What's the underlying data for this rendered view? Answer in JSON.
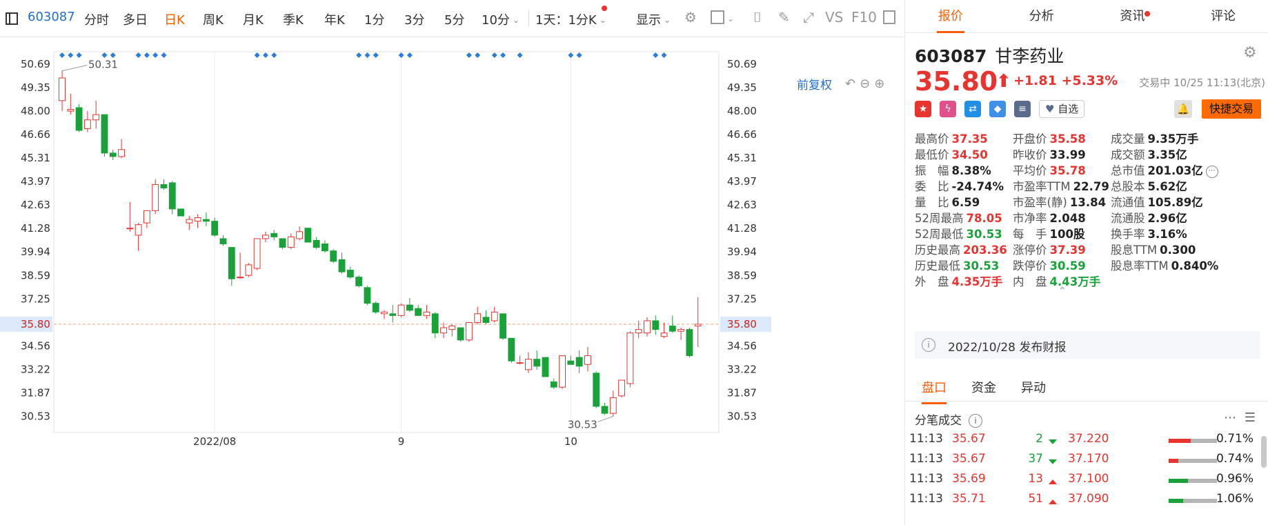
{
  "toolbar": {
    "code": "603087",
    "items": [
      "分时",
      "多日",
      "日K",
      "周K",
      "月K",
      "季K",
      "年K",
      "1分",
      "3分",
      "5分",
      "10分",
      "1天：1分K",
      "显示"
    ],
    "active_index": 2,
    "vs": "VS",
    "f10": "F10"
  },
  "chart": {
    "fq_label": "前复权",
    "price_label": "35.80",
    "high_label": "50.31",
    "low_label": "30.53",
    "x_labels": [
      "2022/08",
      "9",
      "10"
    ]
  },
  "chart_data": {
    "type": "candlestick",
    "yticks": [
      50.69,
      49.35,
      48.0,
      46.66,
      45.31,
      43.97,
      42.63,
      41.28,
      39.94,
      38.59,
      37.25,
      35.8,
      34.56,
      33.22,
      31.87,
      30.53
    ],
    "ylim": [
      29.6,
      51.4
    ],
    "current_price": 35.8,
    "x_labels": [
      {
        "label": "2022/08",
        "index": 18
      },
      {
        "label": "9",
        "index": 40
      },
      {
        "label": "10",
        "index": 60
      }
    ],
    "candles": [
      [
        48.6,
        50.31,
        48.0,
        49.9
      ],
      [
        48.0,
        49.0,
        47.8,
        48.1
      ],
      [
        48.2,
        48.4,
        46.8,
        46.9
      ],
      [
        47.0,
        48.0,
        46.8,
        47.5
      ],
      [
        47.5,
        48.6,
        47.0,
        47.8
      ],
      [
        47.8,
        47.8,
        45.4,
        45.6
      ],
      [
        45.6,
        45.8,
        45.2,
        45.4
      ],
      [
        45.4,
        46.4,
        45.3,
        45.8
      ],
      [
        41.3,
        42.8,
        41.1,
        41.3
      ],
      [
        40.9,
        41.6,
        40.0,
        41.5
      ],
      [
        41.6,
        42.3,
        41.3,
        42.3
      ],
      [
        42.3,
        44.1,
        42.1,
        43.8
      ],
      [
        43.8,
        44.1,
        43.5,
        43.6
      ],
      [
        43.9,
        44.0,
        42.1,
        42.4
      ],
      [
        42.4,
        42.4,
        42.0,
        42.0
      ],
      [
        41.6,
        42.0,
        41.2,
        41.8
      ],
      [
        41.7,
        42.1,
        41.3,
        41.9
      ],
      [
        41.8,
        42.2,
        41.4,
        41.7
      ],
      [
        41.7,
        41.9,
        40.8,
        40.9
      ],
      [
        40.7,
        40.9,
        40.3,
        40.4
      ],
      [
        40.2,
        40.2,
        38.0,
        38.4
      ],
      [
        38.5,
        39.9,
        38.4,
        38.5
      ],
      [
        38.6,
        39.3,
        38.5,
        39.2
      ],
      [
        39.0,
        40.7,
        38.9,
        40.7
      ],
      [
        40.7,
        41.1,
        40.5,
        40.9
      ],
      [
        41.0,
        41.2,
        40.6,
        40.8
      ],
      [
        40.7,
        40.7,
        40.1,
        40.2
      ],
      [
        40.2,
        41.0,
        40.1,
        40.8
      ],
      [
        40.7,
        41.4,
        40.6,
        41.1
      ],
      [
        41.3,
        41.3,
        40.5,
        40.5
      ],
      [
        40.6,
        40.8,
        40.1,
        40.2
      ],
      [
        40.4,
        40.6,
        39.9,
        40.0
      ],
      [
        40.0,
        40.1,
        39.3,
        39.4
      ],
      [
        39.5,
        39.9,
        38.7,
        38.8
      ],
      [
        38.9,
        39.1,
        38.4,
        38.5
      ],
      [
        38.5,
        38.6,
        37.9,
        38.0
      ],
      [
        37.9,
        38.0,
        36.9,
        37.0
      ],
      [
        37.0,
        37.1,
        36.4,
        36.5
      ],
      [
        36.4,
        36.6,
        36.1,
        36.5
      ],
      [
        36.4,
        36.9,
        35.9,
        36.3
      ],
      [
        36.3,
        37.0,
        36.2,
        36.9
      ],
      [
        36.9,
        37.3,
        36.5,
        36.6
      ],
      [
        36.7,
        36.9,
        36.3,
        36.3
      ],
      [
        36.3,
        36.9,
        36.1,
        36.5
      ],
      [
        36.4,
        36.5,
        35.0,
        35.3
      ],
      [
        35.3,
        35.9,
        35.0,
        35.6
      ],
      [
        35.5,
        35.8,
        35.1,
        35.7
      ],
      [
        35.6,
        35.6,
        34.8,
        34.9
      ],
      [
        34.9,
        35.9,
        34.8,
        35.9
      ],
      [
        35.9,
        36.8,
        35.8,
        36.4
      ],
      [
        36.2,
        36.6,
        35.8,
        35.9
      ],
      [
        36.0,
        36.8,
        35.9,
        36.5
      ],
      [
        36.4,
        36.4,
        34.9,
        35.0
      ],
      [
        35.0,
        35.0,
        33.6,
        33.7
      ],
      [
        33.6,
        34.0,
        33.5,
        33.6
      ],
      [
        33.2,
        34.2,
        33.0,
        33.8
      ],
      [
        33.8,
        34.3,
        33.2,
        33.4
      ],
      [
        33.9,
        33.9,
        32.8,
        32.8
      ],
      [
        32.5,
        32.7,
        32.1,
        32.2
      ],
      [
        32.2,
        34.0,
        32.1,
        34.0
      ],
      [
        33.7,
        34.0,
        33.5,
        33.5
      ],
      [
        33.9,
        34.3,
        33.0,
        33.4
      ],
      [
        33.5,
        34.5,
        33.1,
        34.0
      ],
      [
        33.0,
        33.1,
        31.0,
        31.1
      ],
      [
        31.1,
        31.3,
        30.6,
        30.7
      ],
      [
        30.7,
        32.0,
        30.53,
        31.6
      ],
      [
        31.7,
        32.6,
        31.6,
        32.6
      ],
      [
        32.4,
        35.4,
        32.2,
        35.3
      ],
      [
        35.3,
        36.0,
        35.0,
        35.5
      ],
      [
        35.3,
        36.2,
        35.1,
        36.0
      ],
      [
        36.0,
        36.3,
        35.2,
        35.5
      ],
      [
        35.1,
        35.9,
        35.0,
        35.3
      ],
      [
        35.7,
        36.3,
        35.3,
        35.4
      ],
      [
        35.4,
        35.6,
        34.9,
        35.5
      ],
      [
        35.5,
        35.6,
        33.9,
        34.0
      ],
      [
        35.7,
        37.35,
        34.5,
        35.8
      ]
    ]
  },
  "panel": {
    "tabs": [
      "报价",
      "分析",
      "资讯",
      "评论"
    ],
    "code": "603087",
    "name": "甘李药业",
    "price": "35.80",
    "arrow": "⬆",
    "change": "+1.81",
    "change_pct": "+5.33%",
    "trade_time": "交易中 10/25 11:13(北京)",
    "fav_label": "自选",
    "quick_trade": "快捷交易",
    "stats": [
      [
        {
          "label": "最高价",
          "value": "37.35",
          "color": "red"
        },
        {
          "label": "开盘价",
          "value": "35.58",
          "color": "red"
        },
        {
          "label": "成交量",
          "value": "9.35万手",
          "color": "dark"
        }
      ],
      [
        {
          "label": "最低价",
          "value": "34.50",
          "color": "red"
        },
        {
          "label": "昨收价",
          "value": "33.99",
          "color": "dark"
        },
        {
          "label": "成交额",
          "value": "3.35亿",
          "color": "dark"
        }
      ],
      [
        {
          "label": "振　幅",
          "value": "8.38%",
          "color": "dark"
        },
        {
          "label": "平均价",
          "value": "35.78",
          "color": "red"
        },
        {
          "label": "总市值",
          "value": "201.03亿",
          "color": "dark"
        }
      ],
      [
        {
          "label": "委　比",
          "value": "-24.74%",
          "color": "dark"
        },
        {
          "label": "市盈率TTM",
          "value": "22.79",
          "color": "dark"
        },
        {
          "label": "总股本",
          "value": "5.62亿",
          "color": "dark"
        }
      ],
      [
        {
          "label": "量　比",
          "value": "6.59",
          "color": "dark"
        },
        {
          "label": "市盈率(静)",
          "value": "13.84",
          "color": "dark"
        },
        {
          "label": "流通值",
          "value": "105.89亿",
          "color": "dark"
        }
      ],
      [
        {
          "label": "52周最高",
          "value": "78.05",
          "color": "red"
        },
        {
          "label": "市净率",
          "value": "2.048",
          "color": "dark"
        },
        {
          "label": "流通股",
          "value": "2.96亿",
          "color": "dark"
        }
      ],
      [
        {
          "label": "52周最低",
          "value": "30.53",
          "color": "green"
        },
        {
          "label": "每　手",
          "value": "100股",
          "color": "dark"
        },
        {
          "label": "换手率",
          "value": "3.16%",
          "color": "dark"
        }
      ],
      [
        {
          "label": "历史最高",
          "value": "203.36",
          "color": "red"
        },
        {
          "label": "涨停价",
          "value": "37.39",
          "color": "red"
        },
        {
          "label": "股息TTM",
          "value": "0.300",
          "color": "dark"
        }
      ],
      [
        {
          "label": "历史最低",
          "value": "30.53",
          "color": "green"
        },
        {
          "label": "跌停价",
          "value": "30.59",
          "color": "green"
        },
        {
          "label": "股息率TTM",
          "value": "0.840%",
          "color": "dark"
        }
      ],
      [
        {
          "label": "外　盘",
          "value": "4.35万手",
          "color": "red"
        },
        {
          "label": "内　盘",
          "value": "4.43万手",
          "color": "green"
        }
      ]
    ],
    "notice": "2022/10/28  发布财报",
    "subtabs": [
      "盘口",
      "资金",
      "异动"
    ],
    "tick_title": "分笔成交",
    "ticks": [
      {
        "time": "11:13",
        "price": "35.67",
        "vol": "2",
        "dir": "down",
        "pp": "37.220",
        "pct": "0.71%",
        "red_frac": 0.45,
        "green_frac": 0.0
      },
      {
        "time": "11:13",
        "price": "35.67",
        "vol": "37",
        "dir": "down",
        "pp": "37.170",
        "pct": "0.74%",
        "red_frac": 0.2,
        "green_frac": 0.0
      },
      {
        "time": "11:13",
        "price": "35.69",
        "vol": "13",
        "dir": "up",
        "pp": "37.100",
        "pct": "0.96%",
        "red_frac": 0.0,
        "green_frac": 0.4
      },
      {
        "time": "11:13",
        "price": "35.71",
        "vol": "51",
        "dir": "up",
        "pp": "37.090",
        "pct": "1.06%",
        "red_frac": 0.0,
        "green_frac": 0.3
      }
    ]
  }
}
